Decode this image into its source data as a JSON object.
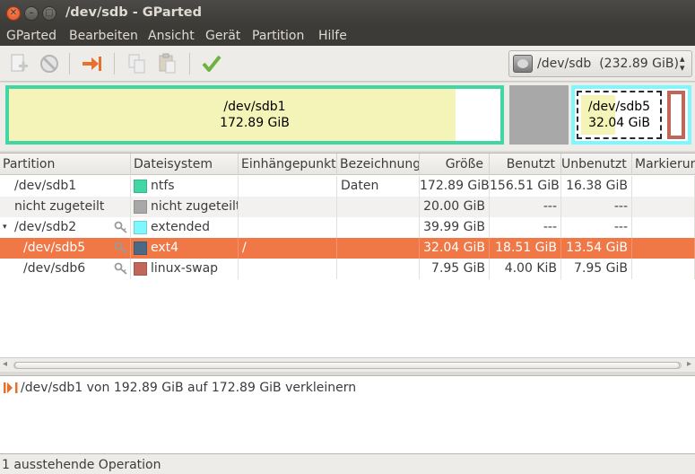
{
  "window": {
    "title": "/dev/sdb - GParted"
  },
  "menubar": {
    "items": [
      "GParted",
      "Bearbeiten",
      "Ansicht",
      "Gerät",
      "Partition",
      "Hilfe"
    ]
  },
  "toolbar": {
    "icons": [
      "new-partition-icon",
      "delete-partition-icon",
      "resize-move-icon",
      "copy-icon",
      "paste-icon",
      "apply-icon"
    ],
    "device_selector": {
      "device": "/dev/sdb",
      "size": "(232.89 GiB)"
    }
  },
  "diskmap": {
    "sdb1": {
      "name": "/dev/sdb1",
      "size": "172.89 GiB"
    },
    "sdb5": {
      "name": "/dev/sdb5",
      "size": "32.04 GiB"
    },
    "colors": {
      "ntfs": "#42d6a4",
      "ntfs_fill": "#f5f4b8",
      "unallocated": "#a8a8a8",
      "extended": "#7ef8fc",
      "ext4": "#4b6983",
      "linux_swap": "#c1665a"
    }
  },
  "table": {
    "headers": [
      "Partition",
      "Dateisystem",
      "Einhängepunkt",
      "Bezeichnung",
      "Größe",
      "Benutzt",
      "Unbenutzt",
      "Markierungen"
    ],
    "rows": [
      {
        "partition": "/dev/sdb1",
        "filesystem": "ntfs",
        "mountpoint": "",
        "label": "Daten",
        "size": "172.89 GiB",
        "used": "156.51 GiB",
        "unused": "16.38 GiB",
        "flags": "",
        "color": "#42d6a4"
      },
      {
        "partition": "nicht zugeteilt",
        "filesystem": "nicht zugeteilt",
        "mountpoint": "",
        "label": "",
        "size": "20.00 GiB",
        "used": "---",
        "unused": "---",
        "flags": "",
        "color": "#a8a8a8"
      },
      {
        "partition": "/dev/sdb2",
        "filesystem": "extended",
        "mountpoint": "",
        "label": "",
        "size": "39.99 GiB",
        "used": "---",
        "unused": "---",
        "flags": "",
        "color": "#7ef8fc"
      },
      {
        "partition": "/dev/sdb5",
        "filesystem": "ext4",
        "mountpoint": "/",
        "label": "",
        "size": "32.04 GiB",
        "used": "18.51 GiB",
        "unused": "13.54 GiB",
        "flags": "",
        "color": "#4b6983"
      },
      {
        "partition": "/dev/sdb6",
        "filesystem": "linux-swap",
        "mountpoint": "",
        "label": "",
        "size": "7.95 GiB",
        "used": "4.00 KiB",
        "unused": "7.95 GiB",
        "flags": "",
        "color": "#c1665a"
      }
    ],
    "selected_row": 3
  },
  "operations": {
    "items": [
      "/dev/sdb1 von 192.89 GiB auf 172.89 GiB verkleinern"
    ]
  },
  "statusbar": {
    "text": "1 ausstehende Operation"
  }
}
